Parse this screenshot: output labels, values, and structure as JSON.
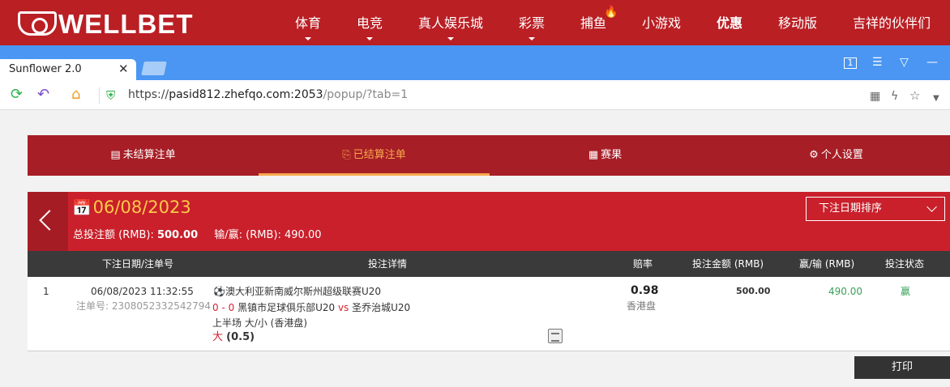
{
  "site": {
    "logo_text": "WELLBET",
    "nav": [
      {
        "label": "体育",
        "has_dropdown": true
      },
      {
        "label": "电竞",
        "has_dropdown": true
      },
      {
        "label": "真人娱乐城",
        "has_dropdown": true
      },
      {
        "label": "彩票",
        "has_dropdown": true
      },
      {
        "label": "捕鱼",
        "has_dropdown": false
      },
      {
        "label": "小游戏",
        "has_dropdown": false
      },
      {
        "label": "优惠",
        "has_dropdown": false
      },
      {
        "label": "移动版",
        "has_dropdown": false
      },
      {
        "label": "吉祥的伙伴们",
        "has_dropdown": false
      }
    ]
  },
  "browser": {
    "tab_title": "Sunflower 2.0",
    "url_prefix": "https://",
    "url_host": "pasid812.zhefqo.com:2053",
    "url_path": "/popup/?tab=1",
    "page_indicator": "1"
  },
  "tabs": [
    {
      "label": "未结算注单",
      "icon": "list-icon"
    },
    {
      "label": "已结算注单",
      "icon": "settled-icon",
      "active": true
    },
    {
      "label": "赛果",
      "icon": "results-icon"
    },
    {
      "label": "个人设置",
      "icon": "gear-icon"
    }
  ],
  "summary": {
    "date": "06/08/2023",
    "total_label": "总投注额 (RMB):",
    "total_value": "500.00",
    "winloss_label": "输/赢: (RMB):",
    "winloss_value": "490.00",
    "sort_label": "下注日期排序"
  },
  "table": {
    "headers": [
      "下注日期/注单号",
      "投注详情",
      "赔率",
      "投注金额 (RMB)",
      "赢/输 (RMB)",
      "投注状态"
    ],
    "rows": [
      {
        "index": "1",
        "datetime": "06/08/2023 11:32:55",
        "ticket": "注单号: 2308052332542794",
        "league": "澳大利亚新南威尔斯州超级联赛U20",
        "score": "0 - 0",
        "home": "黑镇市足球俱乐部U20",
        "vs": "vs",
        "away": "圣乔治城U20",
        "market": "上半场 大/小 (香港盘)",
        "selection": "大",
        "line": "(0.5)",
        "odds": "0.98",
        "odds_type": "香港盘",
        "stake": "500.00",
        "winloss": "490.00",
        "status": "赢"
      }
    ]
  },
  "print_label": "打印",
  "colors": {
    "nav_red": "#ba1f24",
    "tab_red": "#a71e26",
    "summary_red": "#c9202b",
    "accent_orange": "#f7a94d",
    "date_gold": "#ffc94a",
    "win_green": "#3aa05a",
    "browser_blue": "#4a96f2"
  }
}
